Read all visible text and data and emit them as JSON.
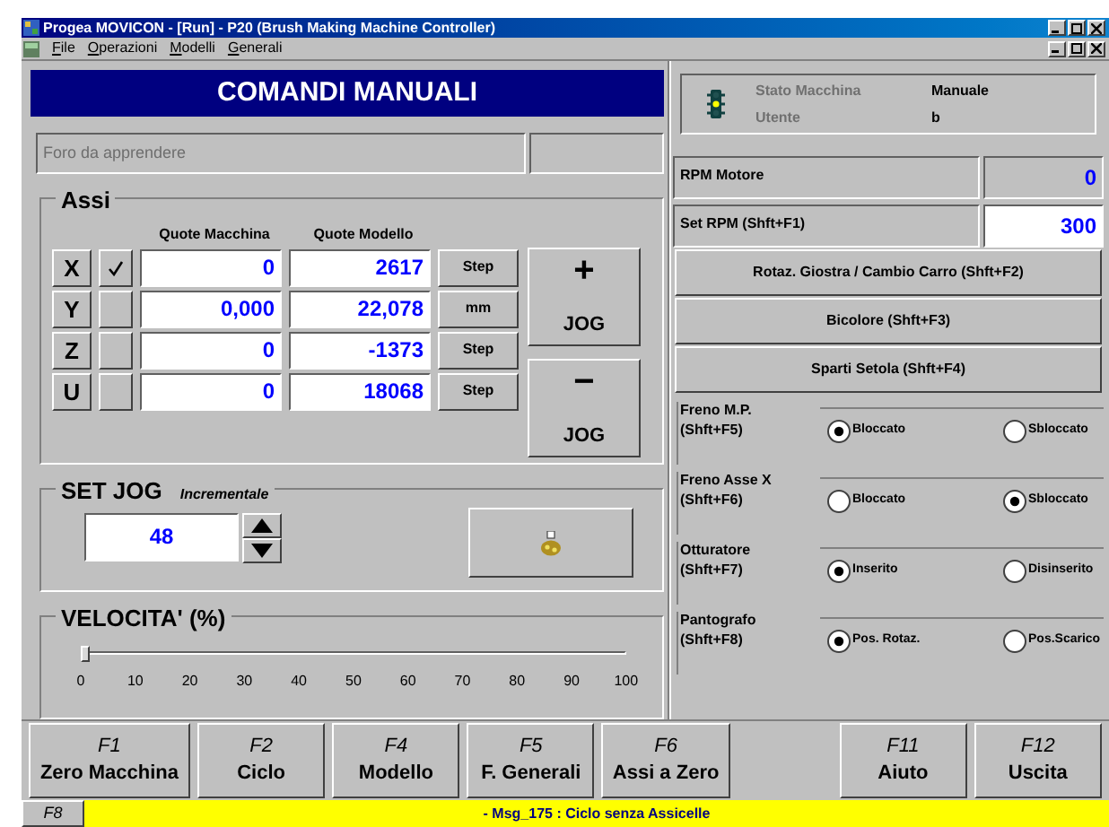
{
  "window": {
    "title": "Progea MOVICON - [Run] - P20 (Brush Making Machine Controller)"
  },
  "menu": [
    "File",
    "Operazioni",
    "Modelli",
    "Generali"
  ],
  "header": "COMANDI MANUALI",
  "foro": {
    "text": "Foro da apprendere"
  },
  "assi": {
    "title": "Assi",
    "columns": [
      "Quote Macchina",
      "Quote Modello"
    ],
    "rows": [
      {
        "axis": "X",
        "checked": true,
        "machine": "0",
        "model": "2617",
        "unit": "Step"
      },
      {
        "axis": "Y",
        "checked": false,
        "machine": "0,000",
        "model": "22,078",
        "unit": "mm"
      },
      {
        "axis": "Z",
        "checked": false,
        "machine": "0",
        "model": "-1373",
        "unit": "Step"
      },
      {
        "axis": "U",
        "checked": false,
        "machine": "0",
        "model": "18068",
        "unit": "Step"
      }
    ],
    "jog": [
      {
        "sign": "+",
        "label": "JOG"
      },
      {
        "sign": "−",
        "label": "JOG"
      }
    ]
  },
  "set_jog": {
    "title": "SET JOG",
    "mode": "Incrementale",
    "value": "48"
  },
  "velocita": {
    "title": "VELOCITA' (%)",
    "level": 0,
    "ticks": [
      "0",
      "10",
      "20",
      "30",
      "40",
      "50",
      "60",
      "70",
      "80",
      "90",
      "100"
    ]
  },
  "status": {
    "rows": [
      {
        "label": "Stato Macchina",
        "value": "Manuale"
      },
      {
        "label": "Utente",
        "value": "b"
      }
    ]
  },
  "rpm": [
    {
      "label": "RPM Motore",
      "value": "0",
      "editable": false
    },
    {
      "label": "Set RPM (Shft+F1)",
      "value": "300",
      "editable": true
    }
  ],
  "actions": [
    "Rotaz. Giostra / Cambio Carro (Shft+F2)",
    "Bicolore (Shft+F3)",
    "Sparti Setola (Shft+F4)"
  ],
  "toggles": [
    {
      "label": "Freno M.P.",
      "shortcut": "(Shft+F5)",
      "options": [
        {
          "label": "Bloccato",
          "selected": true
        },
        {
          "label": "Sbloccato",
          "selected": false
        }
      ]
    },
    {
      "label": "Freno Asse X",
      "shortcut": "(Shft+F6)",
      "options": [
        {
          "label": "Bloccato",
          "selected": false
        },
        {
          "label": "Sbloccato",
          "selected": true
        }
      ]
    },
    {
      "label": "Otturatore",
      "shortcut": "(Shft+F7)",
      "options": [
        {
          "label": "Inserito",
          "selected": true
        },
        {
          "label": "Disinserito",
          "selected": false
        }
      ]
    },
    {
      "label": "Pantografo",
      "shortcut": "(Shft+F8)",
      "options": [
        {
          "label": "Pos. Rotaz.",
          "selected": true
        },
        {
          "label": "Pos.Scarico",
          "selected": false
        }
      ]
    }
  ],
  "function_keys": [
    {
      "key": "F1",
      "label": "Zero Macchina"
    },
    {
      "key": "F2",
      "label": "Ciclo"
    },
    {
      "key": "F4",
      "label": "Modello"
    },
    {
      "key": "F5",
      "label": "F. Generali"
    },
    {
      "key": "F6",
      "label": "Assi a Zero"
    },
    {
      "key": "F11",
      "label": "Aiuto"
    },
    {
      "key": "F12",
      "label": "Uscita"
    }
  ],
  "status_bar": {
    "key": "F8",
    "message": "- Msg_175 : Ciclo senza Assicelle"
  }
}
